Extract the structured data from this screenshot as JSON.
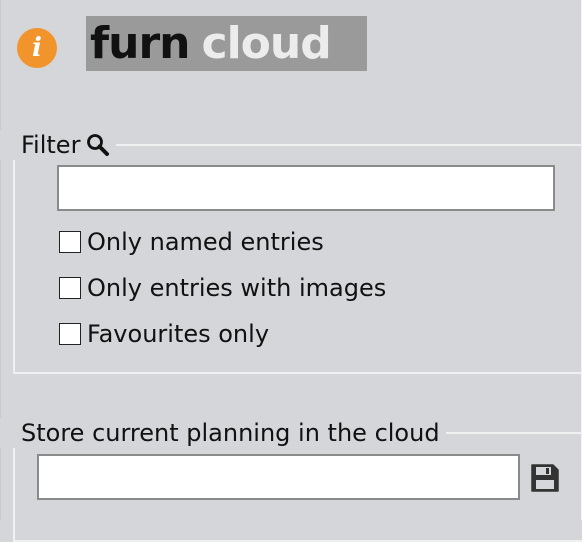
{
  "header": {
    "logo_word1": "furn",
    "logo_word2": "cloud",
    "info_glyph": "i",
    "info_icon": "info-icon",
    "accent_color": "#f0942b"
  },
  "filter": {
    "legend": "Filter",
    "search_icon": "search-icon",
    "input_value": "",
    "options": [
      {
        "label": "Only named entries",
        "checked": false
      },
      {
        "label": "Only entries with images",
        "checked": false
      },
      {
        "label": "Favourites only",
        "checked": false
      }
    ]
  },
  "store": {
    "legend": "Store current planning in the cloud",
    "input_value": "",
    "save_icon": "save-icon"
  }
}
